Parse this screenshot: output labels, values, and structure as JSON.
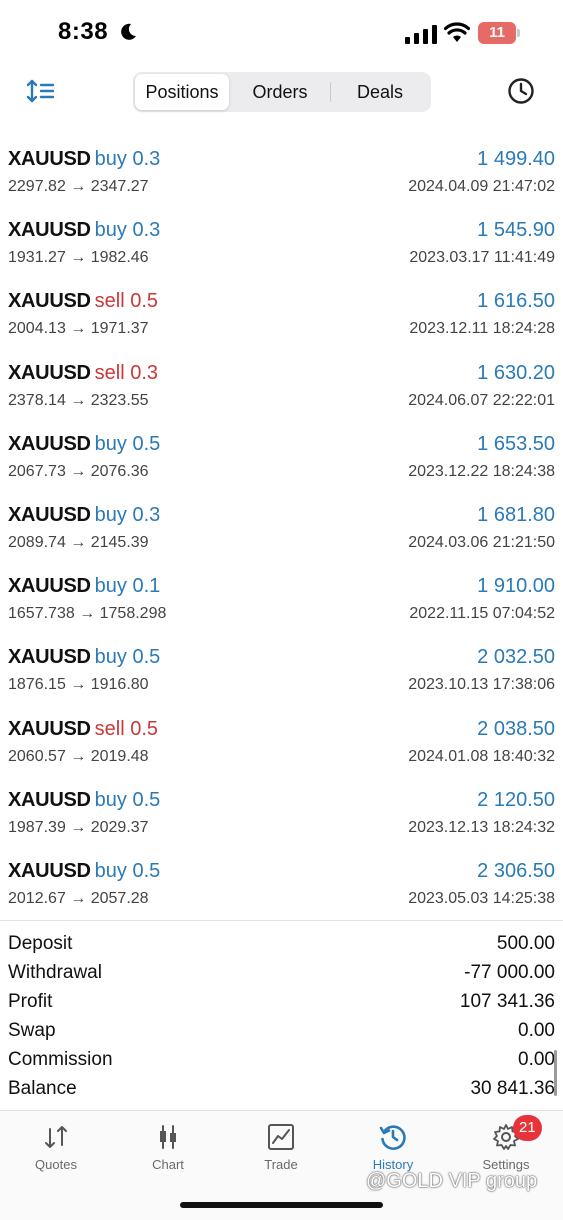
{
  "status_bar": {
    "time": "8:38",
    "battery": "11"
  },
  "top_nav": {
    "tabs": [
      {
        "label": "Positions"
      },
      {
        "label": "Orders"
      },
      {
        "label": "Deals"
      }
    ],
    "active_tab": "Positions"
  },
  "deals": [
    {
      "symbol": "XAUUSD",
      "side": "buy",
      "volume": "0.3",
      "profit": "1 499.40",
      "prices": "2297.82 → 2347.27",
      "date": "2024.04.09 21:47:02"
    },
    {
      "symbol": "XAUUSD",
      "side": "buy",
      "volume": "0.3",
      "profit": "1 545.90",
      "prices": "1931.27 → 1982.46",
      "date": "2023.03.17 11:41:49"
    },
    {
      "symbol": "XAUUSD",
      "side": "sell",
      "volume": "0.5",
      "profit": "1 616.50",
      "prices": "2004.13 → 1971.37",
      "date": "2023.12.11 18:24:28"
    },
    {
      "symbol": "XAUUSD",
      "side": "sell",
      "volume": "0.3",
      "profit": "1 630.20",
      "prices": "2378.14 → 2323.55",
      "date": "2024.06.07 22:22:01"
    },
    {
      "symbol": "XAUUSD",
      "side": "buy",
      "volume": "0.5",
      "profit": "1 653.50",
      "prices": "2067.73 → 2076.36",
      "date": "2023.12.22 18:24:38"
    },
    {
      "symbol": "XAUUSD",
      "side": "buy",
      "volume": "0.3",
      "profit": "1 681.80",
      "prices": "2089.74 → 2145.39",
      "date": "2024.03.06 21:21:50"
    },
    {
      "symbol": "XAUUSD",
      "side": "buy",
      "volume": "0.1",
      "profit": "1 910.00",
      "prices": "1657.738 → 1758.298",
      "date": "2022.11.15 07:04:52"
    },
    {
      "symbol": "XAUUSD",
      "side": "buy",
      "volume": "0.5",
      "profit": "2 032.50",
      "prices": "1876.15 → 1916.80",
      "date": "2023.10.13 17:38:06"
    },
    {
      "symbol": "XAUUSD",
      "side": "sell",
      "volume": "0.5",
      "profit": "2 038.50",
      "prices": "2060.57 → 2019.48",
      "date": "2024.01.08 18:40:32"
    },
    {
      "symbol": "XAUUSD",
      "side": "buy",
      "volume": "0.5",
      "profit": "2 120.50",
      "prices": "1987.39 → 2029.37",
      "date": "2023.12.13 18:24:32"
    },
    {
      "symbol": "XAUUSD",
      "side": "buy",
      "volume": "0.5",
      "profit": "2 306.50",
      "prices": "2012.67 → 2057.28",
      "date": "2023.05.03 14:25:38"
    }
  ],
  "summary": [
    {
      "label": "Deposit",
      "value": "500.00"
    },
    {
      "label": "Withdrawal",
      "value": "-77 000.00"
    },
    {
      "label": "Profit",
      "value": "107 341.36"
    },
    {
      "label": "Swap",
      "value": "0.00"
    },
    {
      "label": "Commission",
      "value": "0.00"
    },
    {
      "label": "Balance",
      "value": "30 841.36"
    }
  ],
  "tab_bar": {
    "tabs": [
      {
        "label": "Quotes",
        "icon": "quotes-icon"
      },
      {
        "label": "Chart",
        "icon": "chart-icon"
      },
      {
        "label": "Trade",
        "icon": "trade-icon"
      },
      {
        "label": "History",
        "icon": "history-icon"
      },
      {
        "label": "Settings",
        "icon": "settings-icon",
        "badge": "21"
      }
    ],
    "active_tab": "History"
  },
  "watermark": "@GOLD VIP group",
  "colors": {
    "accent_blue": "#2a7ab8",
    "sell_red": "#c8393a",
    "badge_red": "#e6343a"
  }
}
